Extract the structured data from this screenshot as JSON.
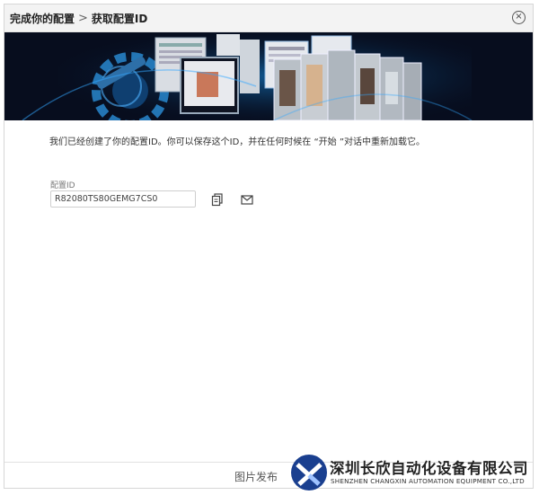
{
  "titlebar": {
    "crumb_1": "完成你的配置",
    "separator": ">",
    "crumb_2": "获取配置ID",
    "close_icon": "close-circle-icon"
  },
  "main": {
    "message": "我们已经创建了你的配置ID。你可以保存这个ID，并在任何时候在 “开始 ”对话中重新加载它。",
    "config_id_label": "配置ID",
    "config_id_value": "R82080TS80GEMG7CS0",
    "copy_icon": "copy-icon",
    "mail_icon": "mail-icon"
  },
  "watermark": {
    "caption": "图片发布",
    "company_name": "深圳长欣自动化设备有限公司",
    "company_name_en": "SHENZHEN CHANGXIN AUTOMATION EQUIPMENT CO.,LTD"
  },
  "colors": {
    "banner_bg": "#070d1e",
    "banner_glow": "#1aa0ff",
    "titlebar_bg": "#f3f3f3"
  }
}
